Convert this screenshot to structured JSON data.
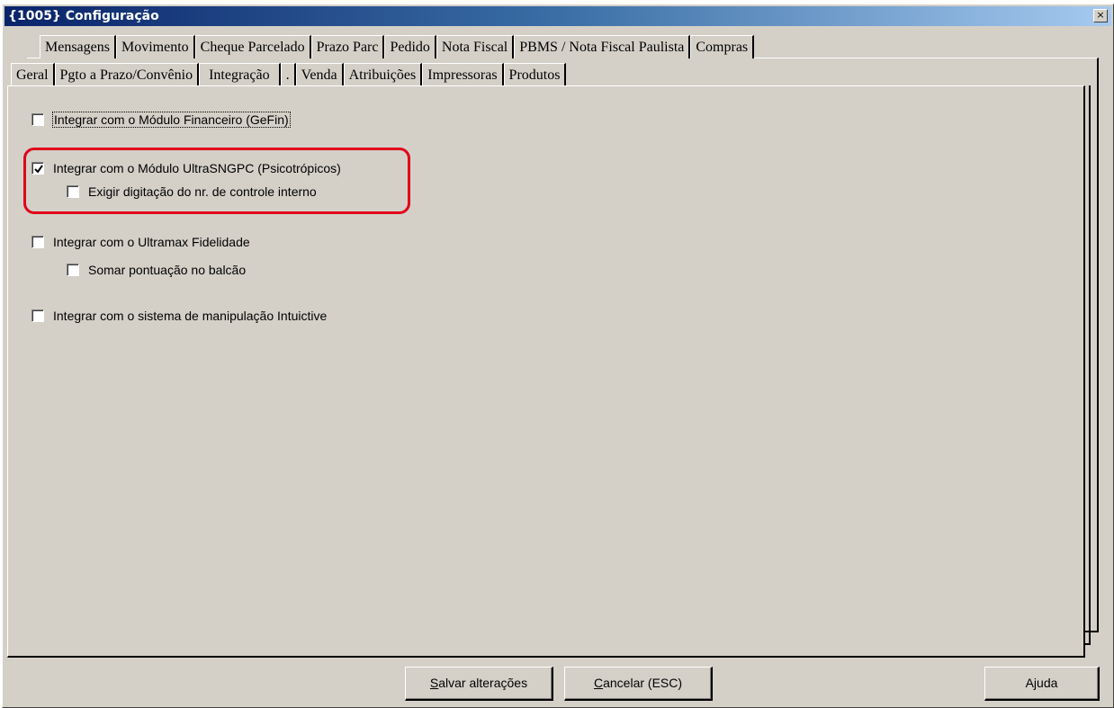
{
  "window": {
    "title": "{1005} Configuração",
    "close_glyph": "×"
  },
  "tabs_back": [
    "Mensagens",
    "Movimento",
    "Cheque Parcelado",
    "Prazo Parc",
    "Pedido",
    "Nota Fiscal",
    "PBMS / Nota Fiscal Paulista",
    "Compras"
  ],
  "tabs_front": [
    "Geral",
    "Pgto a Prazo/Convênio",
    "Integração",
    ".",
    "Venda",
    "Atribuições",
    "Impressoras",
    "Produtos"
  ],
  "active_tab": "Integração",
  "options": {
    "gefin": {
      "label": "Integrar com o Módulo Financeiro (GeFin)",
      "checked": false
    },
    "sngpc": {
      "label": "Integrar com o Módulo UltraSNGPC (Psicotrópicos)",
      "checked": true
    },
    "controle_interno": {
      "label": "Exigir digitação do nr. de controle interno",
      "checked": false
    },
    "fidelidade": {
      "label": "Integrar com o Ultramax Fidelidade",
      "checked": false
    },
    "pontuacao": {
      "label": "Somar pontuação no balcão",
      "checked": false
    },
    "intuictive": {
      "label": "Integrar com o sistema de manipulação Intuictive",
      "checked": false
    }
  },
  "buttons": {
    "save_first": "S",
    "save_rest": "alvar alterações",
    "cancel_first": "C",
    "cancel_rest": "ancelar (ESC)",
    "help": "Ajuda"
  },
  "colors": {
    "highlight": "#e0001a",
    "titlebar_start": "#0a246a",
    "face": "#d4d0c8"
  }
}
